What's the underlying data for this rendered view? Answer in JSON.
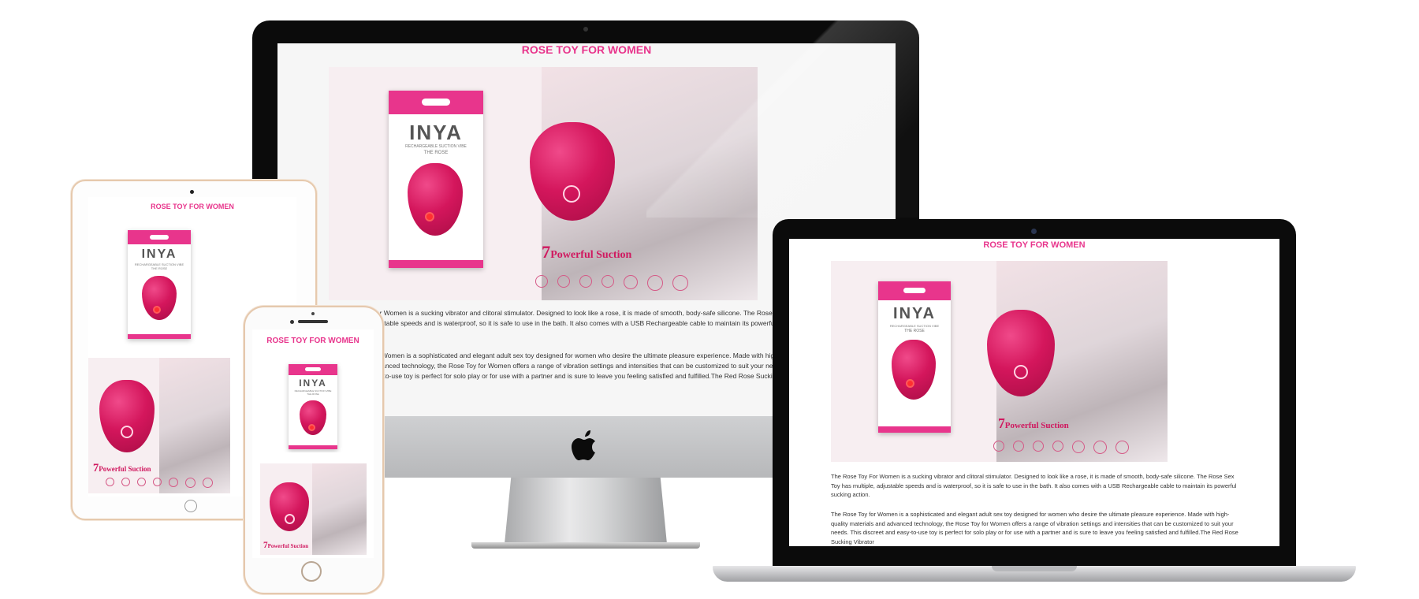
{
  "page": {
    "title": "ROSE TOY FOR WOMEN",
    "paragraph_1": "The Rose Toy For Women is a sucking vibrator and clitoral stimulator. Designed to look like a rose, it is made of smooth, body-safe silicone. The Rose Sex Toy has multiple, adjustable speeds and is waterproof, so it is safe to use in the bath. It also comes with a USB Rechargeable cable to maintain its powerful sucking action.",
    "paragraph_2": "The Rose Toy for Women is a sophisticated and elegant adult sex toy designed for women who desire the ultimate pleasure experience. Made with high-quality materials and advanced technology, the Rose Toy for Women offers a range of vibration settings and intensities that can be customized to suit your needs. This discreet and easy-to-use toy is perfect for solo play or for use with a partner and is sure to leave you feeling satisfied and fulfilled.The Red Rose Sucking Vibrator"
  },
  "product": {
    "brand": "INYA",
    "subtitle": "RECHARGEABLE SUCTION VIBE",
    "name": "THE ROSE",
    "suction_number": "7",
    "suction_text": "Powerful Suction"
  },
  "colors": {
    "accent": "#e8358c",
    "rose": "#d4165c",
    "bezel": "#0b0b0b"
  },
  "icons": {
    "imac_logo": "apple-logo-icon"
  }
}
